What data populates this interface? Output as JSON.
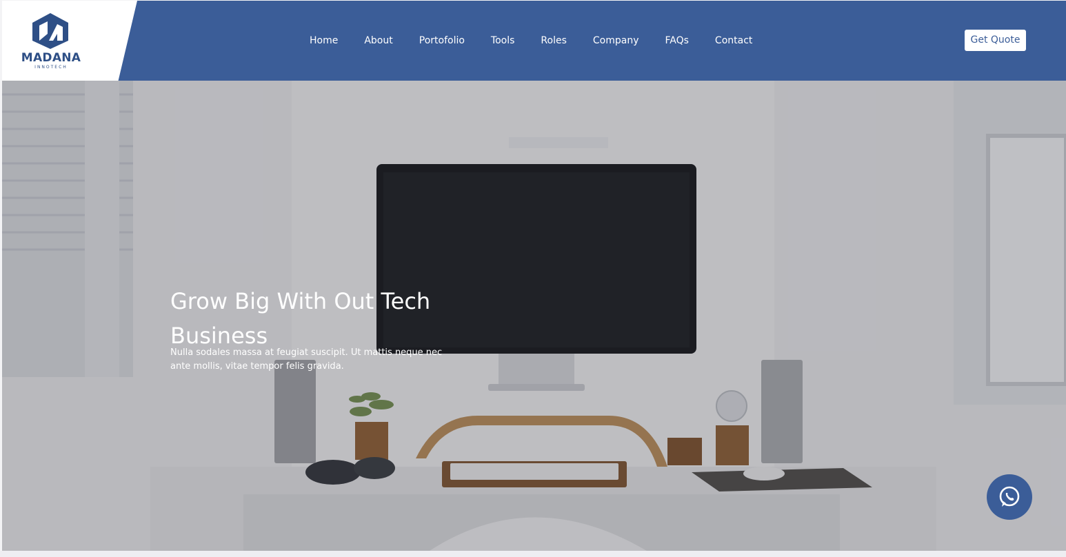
{
  "brand": {
    "name": "MADANA",
    "tagline": "INNOTECH",
    "color": "#3b5d98"
  },
  "nav": {
    "items": [
      {
        "label": "Home"
      },
      {
        "label": "About"
      },
      {
        "label": "Portofolio"
      },
      {
        "label": "Tools"
      },
      {
        "label": "Roles"
      },
      {
        "label": "Company"
      },
      {
        "label": "FAQs"
      },
      {
        "label": "Contact"
      }
    ],
    "cta_label": "Get Quote"
  },
  "hero": {
    "title": "Grow Big With Out Tech Business",
    "text": "Nulla sodales massa at feugiat suscipit. Ut mattis neque nec ante mollis, vitae tempor felis gravida."
  },
  "floating": {
    "icon": "whatsapp-icon"
  },
  "colors": {
    "header": "#3b5d98",
    "accent": "#2e4f86"
  }
}
